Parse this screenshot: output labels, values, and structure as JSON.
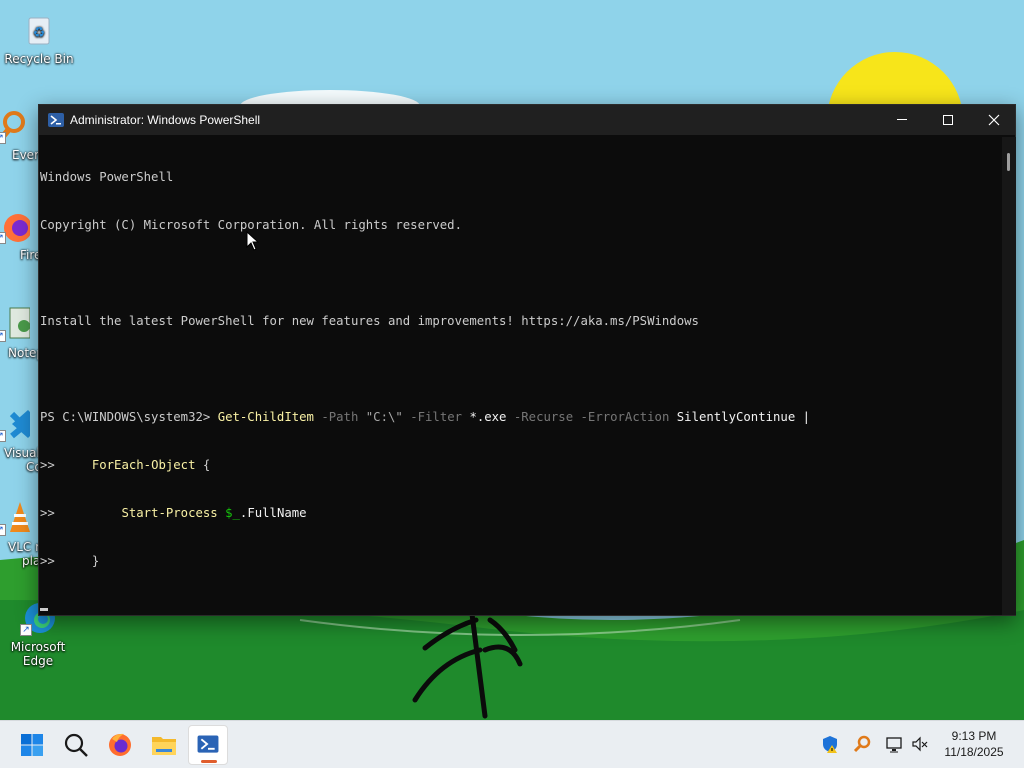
{
  "desktop": {
    "icons": [
      {
        "label": "Recycle Bin"
      },
      {
        "label": "Every"
      },
      {
        "label": "Fire"
      },
      {
        "label": "Notep"
      },
      {
        "label": "Visual"
      },
      {
        "label": "Co"
      },
      {
        "label": "VLC r"
      },
      {
        "label": "pla"
      },
      {
        "label": "Microsoft"
      },
      {
        "label": "Edge"
      }
    ]
  },
  "window": {
    "title": "Administrator: Windows PowerShell",
    "controls": {
      "minimize": "minimize-icon",
      "maximize": "maximize-icon",
      "close": "close-icon"
    }
  },
  "console": {
    "line1": "Windows PowerShell",
    "line2": "Copyright (C) Microsoft Corporation. All rights reserved.",
    "line4": "Install the latest PowerShell for new features and improvements! https://aka.ms/PSWindows",
    "prompt": "PS C:\\WINDOWS\\system32> ",
    "cmd": "Get-ChildItem",
    "p_path": " -Path ",
    "v_path": "\"C:\\\"",
    "p_filter": " -Filter ",
    "v_filter": "*.exe",
    "p_recurse": " -Recurse",
    "p_err": " -ErrorAction ",
    "v_err": "SilentlyContinue",
    "pipe": " |",
    "cont": ">>",
    "foreach_indent": "     ",
    "foreach_cmd": "ForEach-Object",
    "foreach_brace": " {",
    "start_indent": "         ",
    "start_cmd": "Start-Process",
    "start_sp": " ",
    "start_var": "$_",
    "start_prop": ".FullName",
    "close_indent": "     ",
    "close_brace": "}"
  },
  "taskbar": {
    "apps": [
      {
        "name": "start",
        "icon": "windows-start-icon"
      },
      {
        "name": "search",
        "icon": "search-icon"
      },
      {
        "name": "firefox",
        "icon": "firefox-icon"
      },
      {
        "name": "file-explorer",
        "icon": "folder-icon"
      },
      {
        "name": "powershell",
        "icon": "powershell-icon",
        "active": true
      }
    ],
    "tray": [
      "security-shield-icon",
      "search-tool-icon",
      "network-icon",
      "volume-muted-icon"
    ],
    "time": "9:13 PM",
    "date": "11/18/2025"
  },
  "colors": {
    "terminal_bg": "#0c0c0c",
    "titlebar_bg": "#202020",
    "command_yellow": "#f9f1a5",
    "param_gray": "#767676",
    "variable_green": "#16c60c",
    "taskbar_bg": "#eaeef2"
  }
}
